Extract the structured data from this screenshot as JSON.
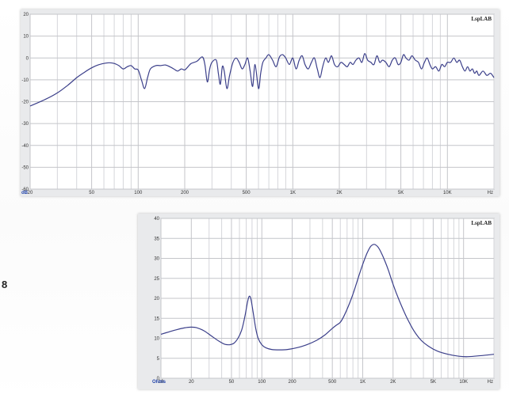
{
  "side_label": "8",
  "chart_data": [
    {
      "type": "line",
      "brand": "LspLAB",
      "y_unit": "dB",
      "x_unit": "Hz",
      "x_scale": "log",
      "xlim": [
        20,
        20000
      ],
      "ylim": [
        -60,
        20
      ],
      "y_ticks": [
        20,
        10,
        0,
        -10,
        -20,
        -30,
        -40,
        -50,
        -60
      ],
      "x_ticks": [
        {
          "value": 20,
          "label": "20"
        },
        {
          "value": 50,
          "label": "50"
        },
        {
          "value": 100,
          "label": "100"
        },
        {
          "value": 200,
          "label": "200"
        },
        {
          "value": 500,
          "label": "500"
        },
        {
          "value": 1000,
          "label": "1K"
        },
        {
          "value": 2000,
          "label": "2K"
        },
        {
          "value": 5000,
          "label": "5K"
        },
        {
          "value": 10000,
          "label": "10K"
        }
      ],
      "grid": true,
      "curve_color": "#3b3f8a",
      "series": [
        {
          "points": [
            [
              20,
              -22
            ],
            [
              25,
              -19
            ],
            [
              30,
              -16
            ],
            [
              35,
              -12.5
            ],
            [
              40,
              -9
            ],
            [
              45,
              -6.5
            ],
            [
              50,
              -4.5
            ],
            [
              55,
              -3.2
            ],
            [
              60,
              -2.5
            ],
            [
              65,
              -2.2
            ],
            [
              70,
              -2.5
            ],
            [
              75,
              -3.5
            ],
            [
              80,
              -5
            ],
            [
              85,
              -4
            ],
            [
              90,
              -3.5
            ],
            [
              95,
              -5
            ],
            [
              100,
              -5.5
            ],
            [
              105,
              -10
            ],
            [
              110,
              -14
            ],
            [
              115,
              -9
            ],
            [
              120,
              -5
            ],
            [
              130,
              -3.5
            ],
            [
              140,
              -3.5
            ],
            [
              150,
              -3.2
            ],
            [
              160,
              -4
            ],
            [
              170,
              -5
            ],
            [
              180,
              -6
            ],
            [
              190,
              -5
            ],
            [
              200,
              -5.5
            ],
            [
              210,
              -4
            ],
            [
              220,
              -2.5
            ],
            [
              240,
              -1.5
            ],
            [
              260,
              0.5
            ],
            [
              270,
              -3
            ],
            [
              280,
              -11
            ],
            [
              290,
              -5
            ],
            [
              300,
              -2
            ],
            [
              320,
              -1
            ],
            [
              330,
              -7
            ],
            [
              340,
              -12
            ],
            [
              350,
              -4
            ],
            [
              360,
              -6
            ],
            [
              375,
              -14
            ],
            [
              390,
              -8
            ],
            [
              410,
              -2
            ],
            [
              430,
              0
            ],
            [
              450,
              -2
            ],
            [
              470,
              -5
            ],
            [
              490,
              -3
            ],
            [
              510,
              0
            ],
            [
              530,
              -6
            ],
            [
              550,
              -13
            ],
            [
              570,
              -3
            ],
            [
              600,
              -14
            ],
            [
              620,
              -7
            ],
            [
              640,
              -2
            ],
            [
              670,
              0
            ],
            [
              700,
              1.5
            ],
            [
              740,
              -1
            ],
            [
              780,
              -4
            ],
            [
              820,
              0.5
            ],
            [
              860,
              1.5
            ],
            [
              900,
              0
            ],
            [
              950,
              -3
            ],
            [
              1000,
              0
            ],
            [
              1050,
              -5
            ],
            [
              1100,
              -1
            ],
            [
              1150,
              1
            ],
            [
              1200,
              -3
            ],
            [
              1260,
              -5
            ],
            [
              1320,
              -2
            ],
            [
              1380,
              0
            ],
            [
              1440,
              -5
            ],
            [
              1500,
              -9
            ],
            [
              1560,
              -4
            ],
            [
              1630,
              0
            ],
            [
              1700,
              -2
            ],
            [
              1780,
              1
            ],
            [
              1860,
              -3
            ],
            [
              1950,
              -4
            ],
            [
              2050,
              -2
            ],
            [
              2150,
              -3
            ],
            [
              2250,
              -4
            ],
            [
              2350,
              -2
            ],
            [
              2450,
              -3
            ],
            [
              2560,
              -1
            ],
            [
              2680,
              0
            ],
            [
              2800,
              -2
            ],
            [
              2920,
              2
            ],
            [
              3050,
              -1
            ],
            [
              3200,
              -2
            ],
            [
              3350,
              -3
            ],
            [
              3500,
              1
            ],
            [
              3650,
              -2
            ],
            [
              3800,
              -1
            ],
            [
              4000,
              -2
            ],
            [
              4200,
              -4
            ],
            [
              4400,
              -1
            ],
            [
              4600,
              0
            ],
            [
              4800,
              -3
            ],
            [
              5000,
              -2
            ],
            [
              5200,
              1.5
            ],
            [
              5400,
              0
            ],
            [
              5650,
              -1
            ],
            [
              5900,
              1
            ],
            [
              6200,
              -1
            ],
            [
              6500,
              -2
            ],
            [
              6800,
              -5
            ],
            [
              7100,
              -2
            ],
            [
              7400,
              0
            ],
            [
              7700,
              -3
            ],
            [
              8000,
              -5
            ],
            [
              8400,
              -4
            ],
            [
              8800,
              -6
            ],
            [
              9200,
              -3
            ],
            [
              9600,
              -4
            ],
            [
              10000,
              -2
            ],
            [
              10500,
              -2
            ],
            [
              11000,
              0
            ],
            [
              11500,
              -2
            ],
            [
              12000,
              -1
            ],
            [
              12500,
              -4
            ],
            [
              13000,
              -6
            ],
            [
              13500,
              -4
            ],
            [
              14000,
              -6
            ],
            [
              14500,
              -5
            ],
            [
              15000,
              -7
            ],
            [
              15500,
              -6
            ],
            [
              16000,
              -8
            ],
            [
              17000,
              -6
            ],
            [
              18000,
              -8
            ],
            [
              19000,
              -7
            ],
            [
              20000,
              -9
            ]
          ]
        }
      ]
    },
    {
      "type": "line",
      "brand": "LspLAB",
      "y_unit": "Ohms",
      "x_unit": "Hz",
      "x_scale": "log",
      "xlim": [
        10,
        20000
      ],
      "ylim": [
        0,
        40
      ],
      "y_ticks": [
        40,
        35,
        30,
        25,
        20,
        15,
        10,
        5,
        0
      ],
      "x_ticks": [
        {
          "value": 10,
          "label": "10"
        },
        {
          "value": 20,
          "label": "20"
        },
        {
          "value": 50,
          "label": "50"
        },
        {
          "value": 100,
          "label": "100"
        },
        {
          "value": 200,
          "label": "200"
        },
        {
          "value": 500,
          "label": "500"
        },
        {
          "value": 1000,
          "label": "1K"
        },
        {
          "value": 2000,
          "label": "2K"
        },
        {
          "value": 5000,
          "label": "5K"
        },
        {
          "value": 10000,
          "label": "10K"
        }
      ],
      "grid": true,
      "curve_color": "#3b3f8a",
      "series": [
        {
          "points": [
            [
              10,
              11
            ],
            [
              12,
              11.6
            ],
            [
              14,
              12.1
            ],
            [
              17,
              12.6
            ],
            [
              20,
              12.8
            ],
            [
              23,
              12.6
            ],
            [
              27,
              11.8
            ],
            [
              32,
              10.5
            ],
            [
              38,
              9.2
            ],
            [
              43,
              8.5
            ],
            [
              48,
              8.4
            ],
            [
              53,
              8.8
            ],
            [
              58,
              10
            ],
            [
              63,
              12
            ],
            [
              68,
              15.5
            ],
            [
              72,
              19
            ],
            [
              75,
              20.5
            ],
            [
              78,
              19.8
            ],
            [
              82,
              16.5
            ],
            [
              87,
              12.5
            ],
            [
              92,
              10
            ],
            [
              100,
              8.4
            ],
            [
              110,
              7.6
            ],
            [
              125,
              7.2
            ],
            [
              150,
              7.1
            ],
            [
              180,
              7.2
            ],
            [
              220,
              7.6
            ],
            [
              280,
              8.4
            ],
            [
              350,
              9.5
            ],
            [
              420,
              10.8
            ],
            [
              500,
              12.5
            ],
            [
              550,
              13.3
            ],
            [
              600,
              14
            ],
            [
              650,
              15.5
            ],
            [
              720,
              18
            ],
            [
              800,
              21
            ],
            [
              900,
              25
            ],
            [
              1000,
              28.5
            ],
            [
              1100,
              31.2
            ],
            [
              1200,
              33
            ],
            [
              1300,
              33.5
            ],
            [
              1400,
              33
            ],
            [
              1500,
              31.8
            ],
            [
              1650,
              29.5
            ],
            [
              1800,
              27
            ],
            [
              2000,
              23.5
            ],
            [
              2300,
              19.5
            ],
            [
              2700,
              15.5
            ],
            [
              3200,
              12
            ],
            [
              3800,
              9.5
            ],
            [
              4500,
              8
            ],
            [
              5500,
              6.8
            ],
            [
              7000,
              6
            ],
            [
              9000,
              5.5
            ],
            [
              11000,
              5.4
            ],
            [
              14000,
              5.6
            ],
            [
              17000,
              5.8
            ],
            [
              20000,
              6
            ]
          ]
        }
      ]
    }
  ]
}
